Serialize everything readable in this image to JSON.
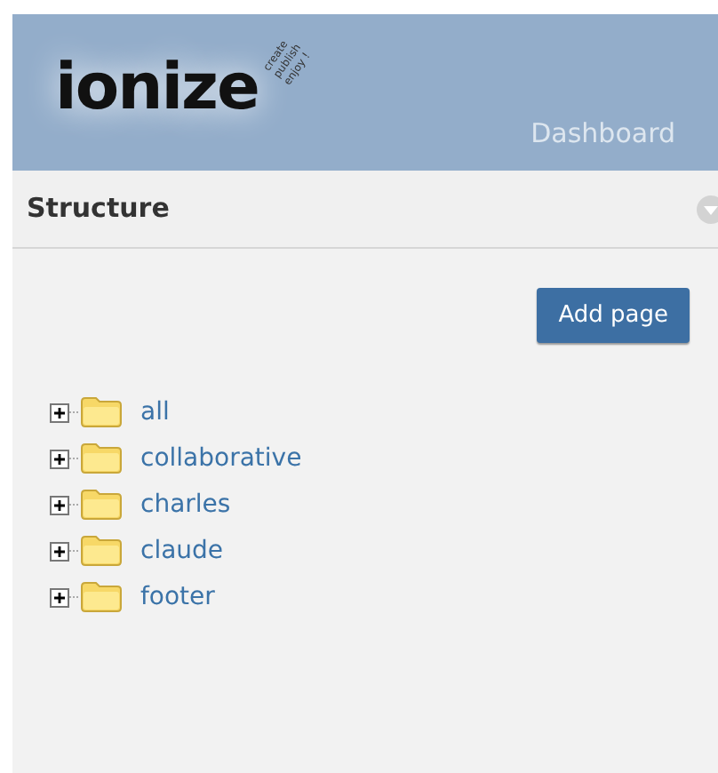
{
  "header": {
    "logo": "ionize",
    "tagline": [
      "create",
      "publish",
      "enjoy !"
    ],
    "nav_link": "Dashboard"
  },
  "panel": {
    "title": "Structure",
    "collapsed": false,
    "add_button": "Add page",
    "tree": [
      {
        "label": "all",
        "expanded": false
      },
      {
        "label": "collaborative",
        "expanded": false
      },
      {
        "label": "charles",
        "expanded": false
      },
      {
        "label": "claude",
        "expanded": false
      },
      {
        "label": "footer",
        "expanded": false
      }
    ]
  }
}
